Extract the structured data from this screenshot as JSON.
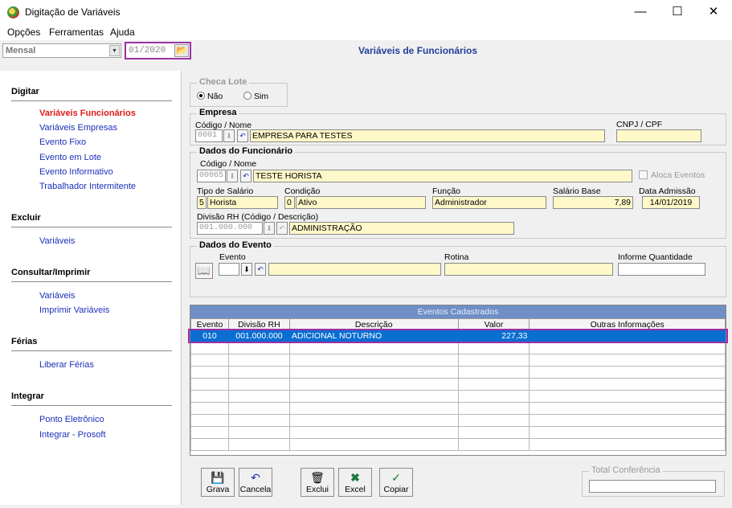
{
  "window": {
    "title": "Digitação de Variáveis",
    "min": "—",
    "max": "☐",
    "close": "✕"
  },
  "menu": {
    "opcoes": "Opções",
    "ferramentas": "Ferramentas",
    "ajuda": "Ajuda"
  },
  "top": {
    "period": "Mensal",
    "date": "01/2020",
    "page_title": "Variáveis de Funcionários"
  },
  "sidebar": {
    "digitar": "Digitar",
    "digitar_items": [
      "Variáveis Funcionários",
      "Variáveis Empresas",
      "Evento Fixo",
      "Evento em Lote",
      "Evento Informativo",
      "Trabalhador Intermitente"
    ],
    "excluir": "Excluir",
    "excluir_items": [
      "Variáveis"
    ],
    "consultar": "Consultar/Imprimir",
    "consultar_items": [
      "Variáveis",
      "Imprimir Variáveis"
    ],
    "ferias": "Férias",
    "ferias_items": [
      "Liberar Férias"
    ],
    "integrar": "Integrar",
    "integrar_items": [
      "Ponto Eletrônico",
      "Integrar - Prosoft"
    ]
  },
  "checa_lote": {
    "title": "Checa Lote",
    "nao": "Não",
    "sim": "Sim",
    "selected": "Não"
  },
  "empresa": {
    "title": "Empresa",
    "codigo_label": "Código / Nome",
    "codigo": "0001",
    "nome": "EMPRESA PARA TESTES",
    "cnpj_label": "CNPJ / CPF",
    "cnpj": ""
  },
  "funcionario": {
    "title": "Dados do Funcionário",
    "codigo_label": "Código / Nome",
    "codigo": "00065",
    "nome": "TESTE HORISTA",
    "aloca_label": "Aloca Eventos",
    "tipo_label": "Tipo de Salário",
    "tipo_cod": "5",
    "tipo": "Horista",
    "condicao_label": "Condição",
    "condicao_cod": "0",
    "condicao": "Ativo",
    "funcao_label": "Função",
    "funcao": "Administrador",
    "salario_label": "Salário Base",
    "salario": "7,89",
    "admissao_label": "Data Admissão",
    "admissao": "14/01/2019",
    "divisao_label": "Divisão RH (Código / Descrição)",
    "divisao_cod": "001.000.000",
    "divisao": "ADMINISTRAÇÃO"
  },
  "evento": {
    "title": "Dados do Evento",
    "evento_label": "Evento",
    "rotina_label": "Rotina",
    "quantidade_label": "Informe Quantidade"
  },
  "grid": {
    "caption": "Eventos Cadastrados",
    "headers": [
      "Evento",
      "Divisão RH",
      "Descrição",
      "Valor",
      "Outras Informações"
    ],
    "rows": [
      {
        "evento": "010",
        "divisao": "001.000.000",
        "descricao": "ADICIONAL NOTURNO",
        "valor": "227,33",
        "outras": ""
      }
    ]
  },
  "toolbar": {
    "grava": "Grava",
    "cancela": "Cancela",
    "exclui": "Exclui",
    "excel": "Excel",
    "copiar": "Copiar"
  },
  "total": {
    "label": "Total Conferência",
    "value": ""
  }
}
